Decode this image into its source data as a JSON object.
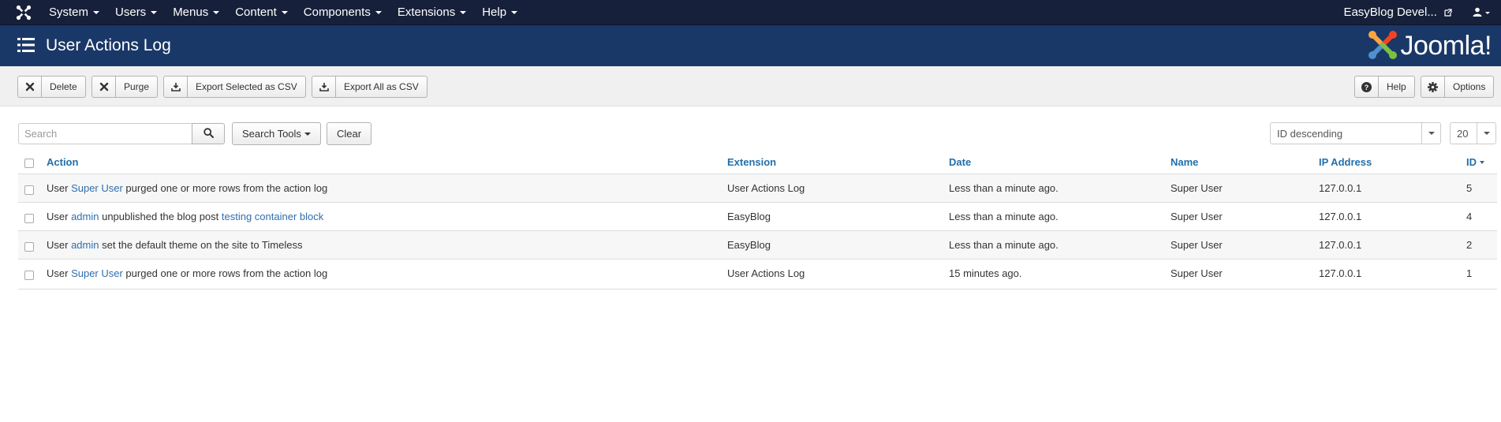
{
  "navbar": {
    "menu": [
      "System",
      "Users",
      "Menus",
      "Content",
      "Components",
      "Extensions",
      "Help"
    ],
    "site_name": "EasyBlog Devel..."
  },
  "header": {
    "title": "User Actions Log",
    "brand": "Joomla!"
  },
  "toolbar": {
    "delete": "Delete",
    "purge": "Purge",
    "export_selected": "Export Selected as CSV",
    "export_all": "Export All as CSV",
    "help": "Help",
    "options": "Options"
  },
  "filters": {
    "search_placeholder": "Search",
    "search_tools": "Search Tools",
    "clear": "Clear",
    "ordering": "ID descending",
    "limit": "20"
  },
  "table": {
    "columns": {
      "action": "Action",
      "extension": "Extension",
      "date": "Date",
      "name": "Name",
      "ip": "IP Address",
      "id": "ID"
    },
    "rows": [
      {
        "action": [
          {
            "t": "User "
          },
          {
            "t": "Super User",
            "link": true
          },
          {
            "t": " purged one or more rows from the action log"
          }
        ],
        "extension": "User Actions Log",
        "date": "Less than a minute ago.",
        "name": "Super User",
        "ip": "127.0.0.1",
        "id": "5"
      },
      {
        "action": [
          {
            "t": "User "
          },
          {
            "t": "admin",
            "link": true
          },
          {
            "t": " unpublished the blog post "
          },
          {
            "t": "testing container block",
            "link": true
          }
        ],
        "extension": "EasyBlog",
        "date": "Less than a minute ago.",
        "name": "Super User",
        "ip": "127.0.0.1",
        "id": "4"
      },
      {
        "action": [
          {
            "t": "User "
          },
          {
            "t": "admin",
            "link": true
          },
          {
            "t": " set the default theme on the site to Timeless"
          }
        ],
        "extension": "EasyBlog",
        "date": "Less than a minute ago.",
        "name": "Super User",
        "ip": "127.0.0.1",
        "id": "2"
      },
      {
        "action": [
          {
            "t": "User "
          },
          {
            "t": "Super User",
            "link": true
          },
          {
            "t": " purged one or more rows from the action log"
          }
        ],
        "extension": "User Actions Log",
        "date": "15 minutes ago.",
        "name": "Super User",
        "ip": "127.0.0.1",
        "id": "1"
      }
    ]
  },
  "colors": {
    "navbar": "#17203a",
    "header": "#1a3867",
    "link": "#2f6ead",
    "toolbar": "#f0f0f0"
  }
}
